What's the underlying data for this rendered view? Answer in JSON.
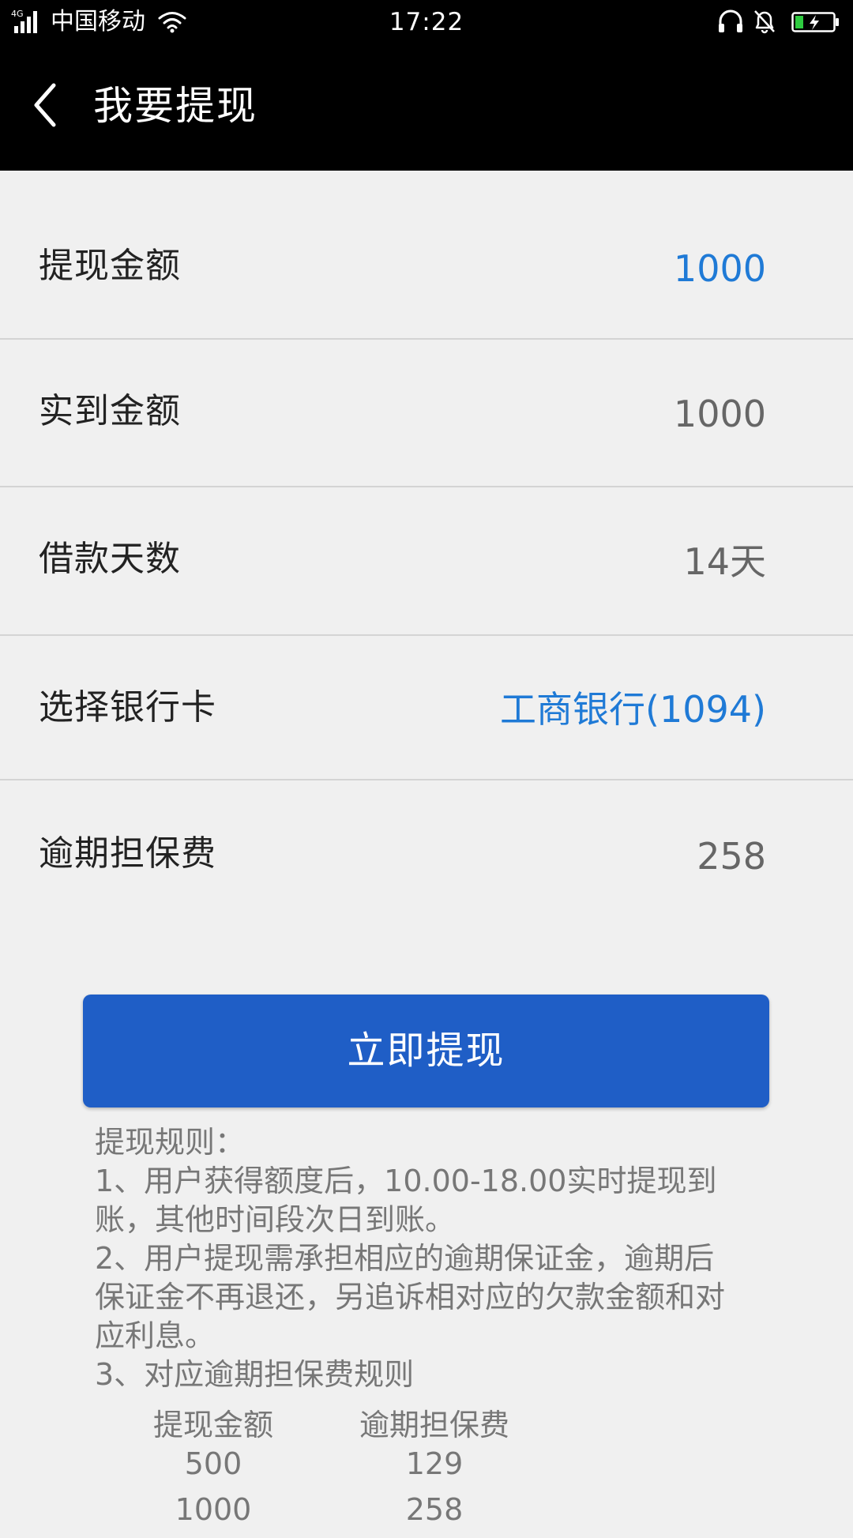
{
  "status_bar": {
    "network_type": "4G",
    "carrier": "中国移动",
    "time": "17:22",
    "icons": [
      "signal-icon",
      "wifi-icon",
      "headset-icon",
      "bell-icon",
      "battery-charging-icon"
    ]
  },
  "header": {
    "title": "我要提现",
    "back_icon": "chevron-left-icon"
  },
  "form": {
    "rows": [
      {
        "label": "提现金额",
        "value": "1000"
      },
      {
        "label": "实到金额",
        "value": "1000"
      },
      {
        "label": "借款天数",
        "value": "14天"
      },
      {
        "label": "选择银行卡",
        "value": "工商银行(1094)"
      },
      {
        "label": "逾期担保费",
        "value": "258"
      }
    ]
  },
  "submit": {
    "label": "立即提现"
  },
  "rules": {
    "title": "提现规则：",
    "items": [
      "1、用户获得额度后，10.00-18.00实时提现到账，其他时间段次日到账。",
      "2、用户提现需承担相应的逾期保证金，逾期后保证金不再退还，另追诉相对应的欠款金额和对应利息。",
      "3、对应逾期担保费规则"
    ],
    "table": {
      "headers": [
        "提现金额",
        "逾期担保费"
      ],
      "rows": [
        [
          "500",
          "129"
        ],
        [
          "1000",
          "258"
        ]
      ]
    }
  },
  "colors": {
    "accent_blue": "#1f7ad6",
    "button_blue": "#1f5ec6",
    "background": "#f0f0f0",
    "bar_black": "#000000"
  }
}
